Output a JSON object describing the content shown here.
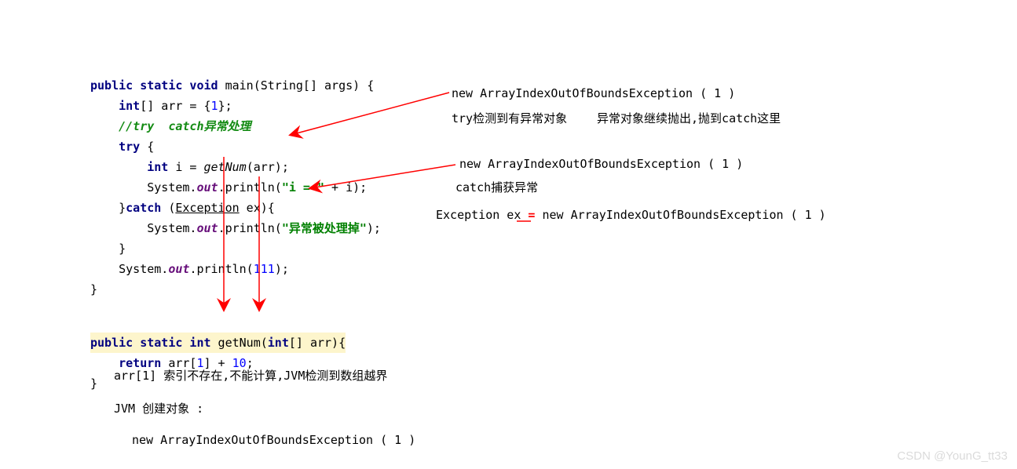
{
  "code": {
    "main_sig": [
      "public static void",
      " main(String[] args) {"
    ],
    "line1": [
      "    ",
      "int",
      "[] arr = {",
      "1",
      "};"
    ],
    "line2": [
      "    ",
      "//try  catch异常处理"
    ],
    "line3": [
      "    ",
      "try",
      " {"
    ],
    "line4": [
      "        ",
      "int",
      " i = ",
      "getNum",
      "(arr);"
    ],
    "line5": [
      "        System.",
      "out",
      ".println(",
      "\"i = \"",
      " + i);"
    ],
    "line6": [
      "    }",
      "catch",
      " (",
      "Exception",
      " ex){"
    ],
    "line7": [
      "        System.",
      "out",
      ".println(",
      "\"异常被处理掉\"",
      ");"
    ],
    "line8": "    }",
    "line9": [
      "    System.",
      "out",
      ".println(",
      "111",
      ");"
    ],
    "line10": "}",
    "getnum_sig": [
      "public static int",
      " getNum(",
      "int",
      "[] arr){"
    ],
    "getnum_body": [
      "    ",
      "return",
      " arr[",
      "1",
      "] + ",
      "10",
      ";"
    ],
    "getnum_close": "}"
  },
  "annot": {
    "a1": "new ArrayIndexOutOfBoundsException ( 1 )",
    "a2a": "try检测到有异常对象",
    "a2b": "异常对象继续抛出,抛到catch这里",
    "a3": "new ArrayIndexOutOfBoundsException ( 1 )",
    "a4": "catch捕获异常",
    "a5a": "Exception ex ",
    "a5b": "=",
    "a5c": " new ArrayIndexOutOfBoundsException ( 1 )",
    "b1": "arr[1] 索引不存在,不能计算,JVM检测到数组越界",
    "b2": "JVM 创建对象 :",
    "b3": "new ArrayIndexOutOfBoundsException ( 1 )"
  },
  "watermark": "CSDN @YounG_tt33"
}
